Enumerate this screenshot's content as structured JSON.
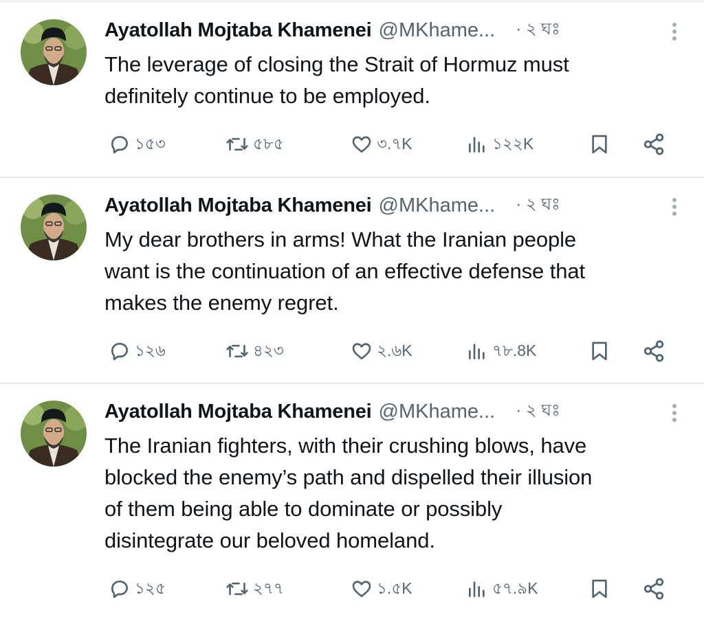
{
  "tweets": [
    {
      "display_name": "Ayatollah Mojtaba Khamenei",
      "handle": "@MKhame...",
      "time": "· ২ ঘঃ",
      "text_lines": [
        "The leverage of closing the Strait of Hormuz must",
        "definitely continue to be employed."
      ],
      "replies": "১৫৩",
      "reposts": "৫৮৫",
      "likes": "৩.৭K",
      "views": "১২২K"
    },
    {
      "display_name": "Ayatollah Mojtaba Khamenei",
      "handle": "@MKhame...",
      "time": "· ২ ঘঃ",
      "text_lines": [
        "My dear brothers in arms! What the Iranian people",
        "want is the continuation of an effective defense that",
        "makes the enemy regret."
      ],
      "replies": "১২৬",
      "reposts": "৪২৩",
      "likes": "২.৬K",
      "views": "৭৮.8K"
    },
    {
      "display_name": "Ayatollah Mojtaba Khamenei",
      "handle": "@MKhame...",
      "time": "· ২ ঘঃ",
      "text_lines": [
        "The Iranian fighters, with their crushing blows, have",
        "blocked the enemy’s path and dispelled their illusion",
        "of them being able to dominate or possibly",
        "disintegrate our beloved homeland."
      ],
      "replies": "১২৫",
      "reposts": "২৭৭",
      "likes": "১.৫K",
      "views": "৫৭.৯K"
    }
  ],
  "icons": {
    "reply": "reply-icon",
    "repost": "repost-icon",
    "like": "heart-icon",
    "views": "views-icon",
    "bookmark": "bookmark-icon",
    "share": "share-icon",
    "more": "more-vertical-icon"
  },
  "colors": {
    "text": "#0f1419",
    "secondary": "#536471",
    "divider": "#e7ebec"
  }
}
